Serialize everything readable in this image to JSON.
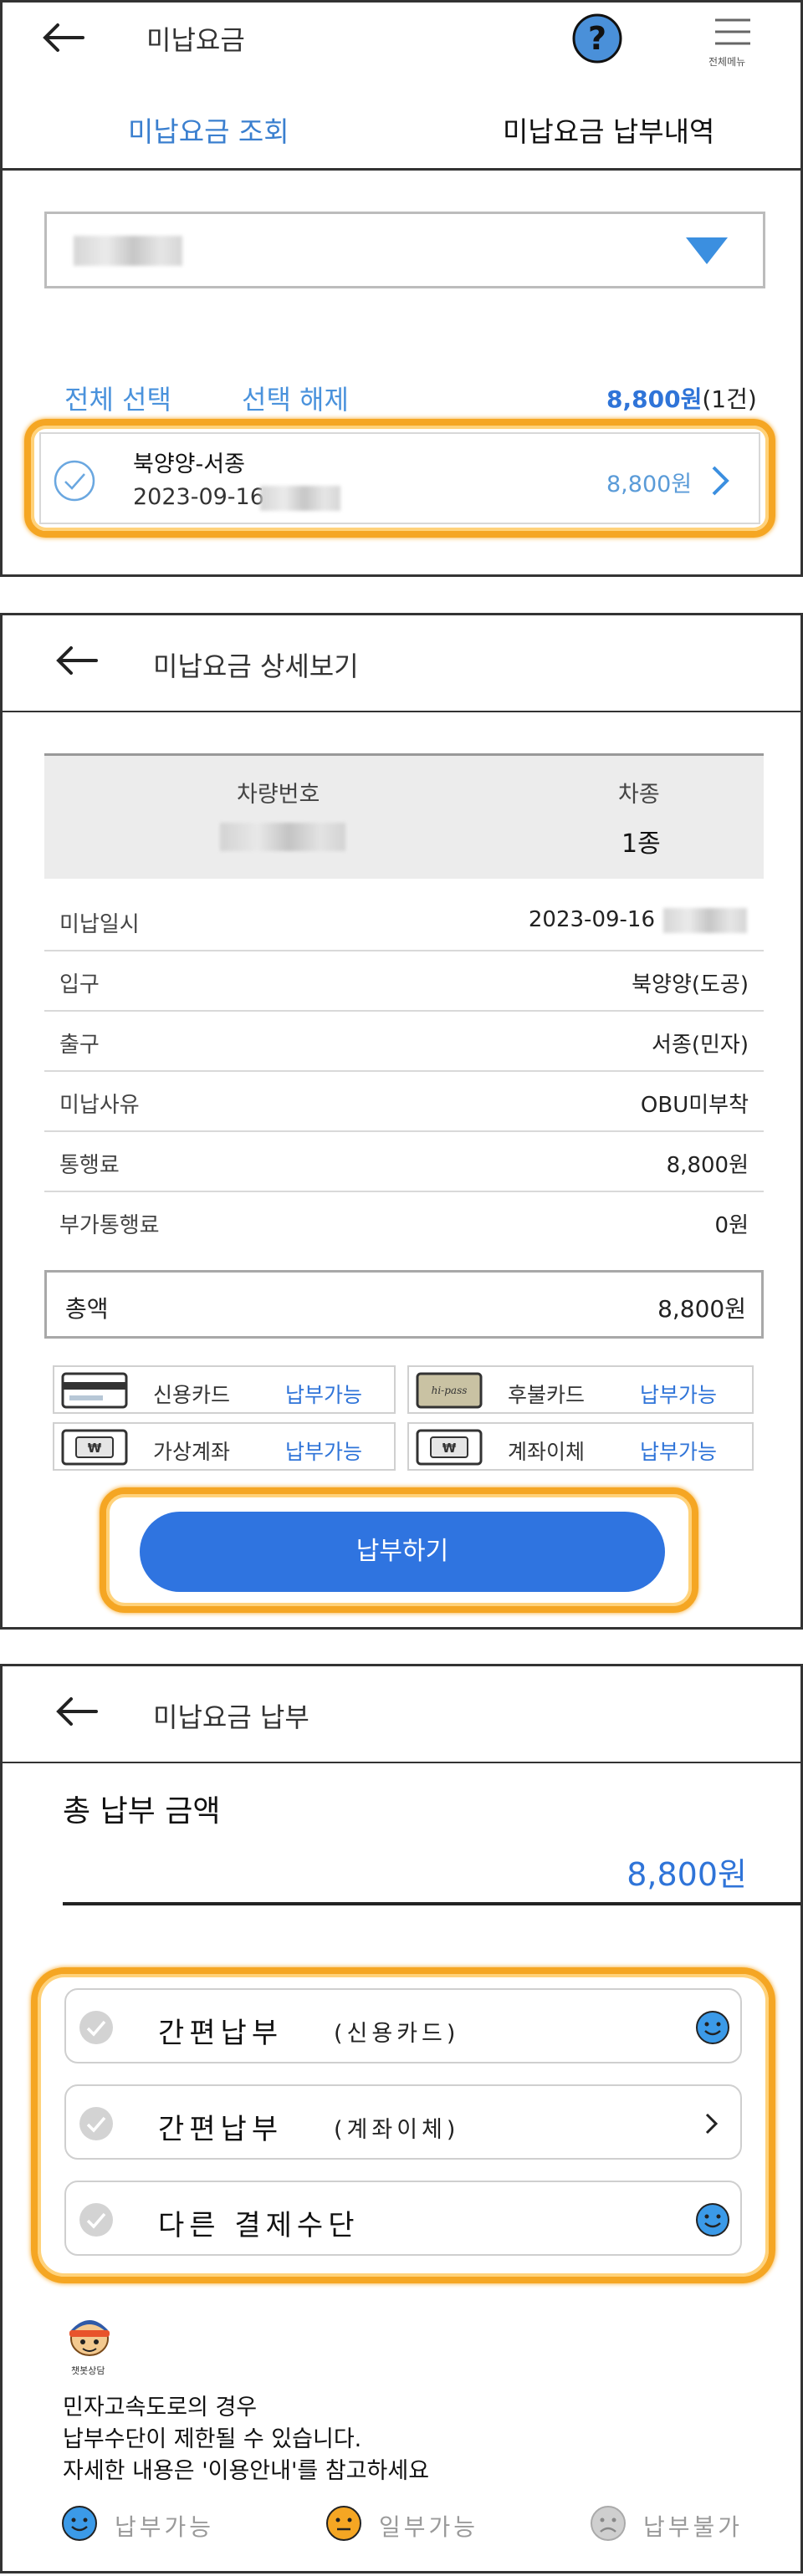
{
  "panel1": {
    "title": "미납요금",
    "menu_label": "전체메뉴",
    "tabs": [
      {
        "label": "미납요금 조회",
        "active": true
      },
      {
        "label": "미납요금 납부내역",
        "active": false
      }
    ],
    "select_all": "전체 선택",
    "deselect": "선택 해제",
    "total_amount": "8,800원",
    "total_count": "(1건)",
    "item": {
      "route": "북양양-서종",
      "date": "2023-09-16",
      "amount": "8,800원"
    }
  },
  "panel2": {
    "title": "미납요금 상세보기",
    "vehicle_number_label": "차량번호",
    "vehicle_type_label": "차종",
    "vehicle_type_value": "1종",
    "rows": [
      {
        "label": "미납일시",
        "value": "2023-09-16"
      },
      {
        "label": "입구",
        "value": "북양양(도공)"
      },
      {
        "label": "출구",
        "value": "서종(민자)"
      },
      {
        "label": "미납사유",
        "value": "OBU미부착"
      },
      {
        "label": "통행료",
        "value": "8,800원"
      },
      {
        "label": "부가통행료",
        "value": "0원"
      }
    ],
    "total_label": "총액",
    "total_value": "8,800원",
    "pay_methods": [
      {
        "name": "신용카드",
        "status": "납부가능",
        "icon": "credit-card-icon"
      },
      {
        "name": "후불카드",
        "status": "납부가능",
        "icon": "hipass-card-icon"
      },
      {
        "name": "가상계좌",
        "status": "납부가능",
        "icon": "virtual-account-icon"
      },
      {
        "name": "계좌이체",
        "status": "납부가능",
        "icon": "bank-transfer-icon"
      }
    ],
    "pay_button": "납부하기",
    "hipass_logo_text": "hi-pass"
  },
  "panel3": {
    "title": "미납요금 납부",
    "total_label": "총 납부 금액",
    "total_value": "8,800원",
    "options": [
      {
        "main": "간편납부",
        "sub": "(신용카드)",
        "indicator": "smile-icon"
      },
      {
        "main": "간편납부",
        "sub": "(계좌이체)",
        "indicator": "chevron-right-icon"
      },
      {
        "main": "다른 결제수단",
        "sub": "",
        "indicator": "smile-icon"
      }
    ],
    "chatbot_label": "챗봇상담",
    "notice_lines": [
      "민자고속도로의 경우",
      "납부수단이 제한될 수 있습니다.",
      "자세한 내용은 '이용안내'를 참고하세요"
    ],
    "legend": [
      {
        "label": "납부가능",
        "color": "#3b9ae8"
      },
      {
        "label": "일부가능",
        "color": "#f5a623"
      },
      {
        "label": "납부불가",
        "color": "#c8c8c8"
      }
    ]
  },
  "colors": {
    "accent_blue": "#2f74d8",
    "light_blue": "#5a9bd8",
    "highlight_orange": "#f5a623"
  }
}
